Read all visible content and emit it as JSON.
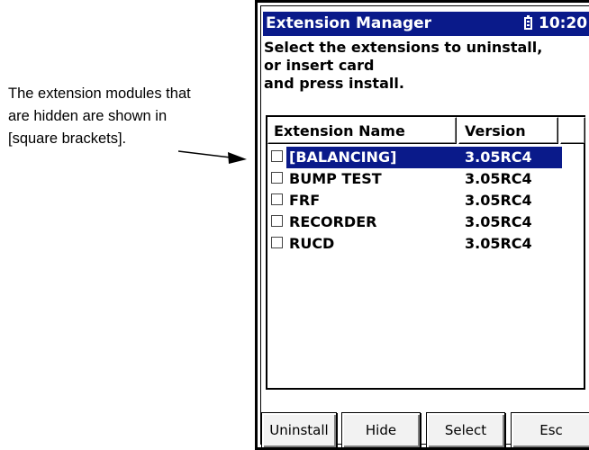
{
  "annotation": {
    "lines": [
      "The extension modules that",
      "are hidden are shown in",
      "[square brackets]."
    ]
  },
  "window": {
    "title": "Extension Manager",
    "time": "10:20",
    "battery_icon": "battery-icon"
  },
  "instruction": {
    "lines": [
      "Select the extensions to uninstall,",
      "or insert card",
      "and press install."
    ]
  },
  "list": {
    "columns": [
      "Extension Name",
      "Version"
    ],
    "rows": [
      {
        "name": "[BALANCING]",
        "version": "3.05RC4",
        "checked": false,
        "selected": true
      },
      {
        "name": "BUMP TEST",
        "version": "3.05RC4",
        "checked": false,
        "selected": false
      },
      {
        "name": "FRF",
        "version": "3.05RC4",
        "checked": false,
        "selected": false
      },
      {
        "name": "RECORDER",
        "version": "3.05RC4",
        "checked": false,
        "selected": false
      },
      {
        "name": "RUCD",
        "version": "3.05RC4",
        "checked": false,
        "selected": false
      }
    ]
  },
  "buttons": {
    "uninstall": "Uninstall",
    "hide": "Hide",
    "select": "Select",
    "esc": "Esc"
  },
  "colors": {
    "titlebar": "#0a1a8a",
    "selection": "#0a1a8a"
  }
}
